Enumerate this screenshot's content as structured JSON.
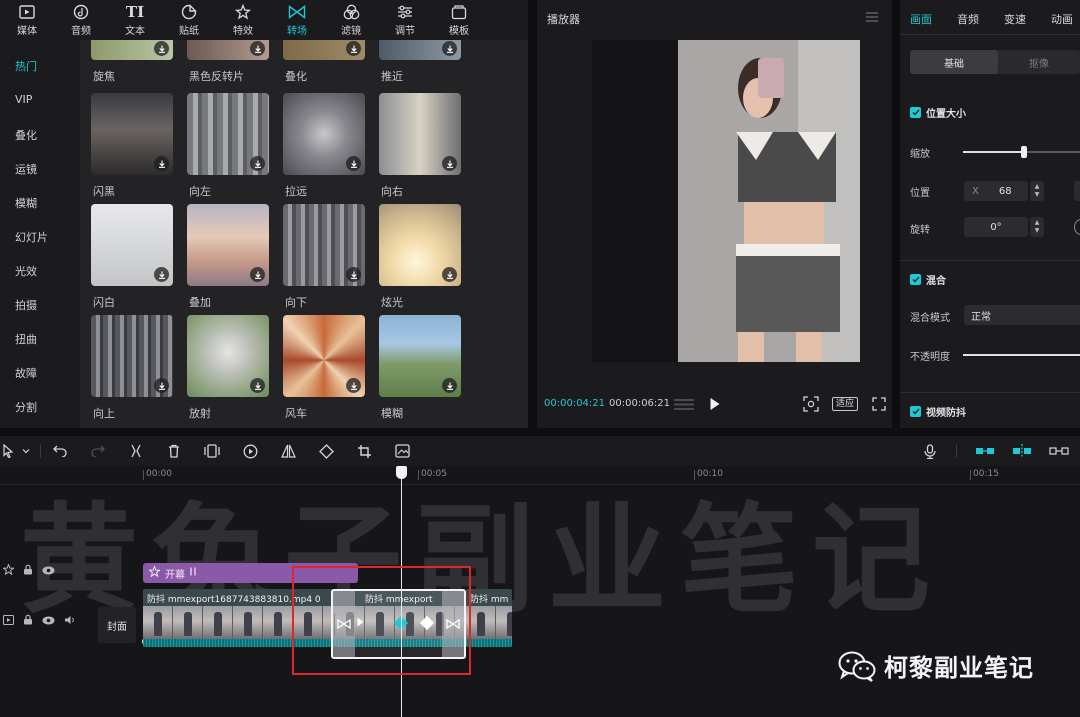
{
  "toolbar": {
    "items": [
      {
        "label": "媒体",
        "icon": "media-icon"
      },
      {
        "label": "音频",
        "icon": "audio-icon"
      },
      {
        "label": "文本",
        "icon": "text-icon",
        "glyph": "TI"
      },
      {
        "label": "贴纸",
        "icon": "sticker-icon"
      },
      {
        "label": "特效",
        "icon": "effects-icon"
      },
      {
        "label": "转场",
        "icon": "transition-icon",
        "active": true
      },
      {
        "label": "滤镜",
        "icon": "filter-icon"
      },
      {
        "label": "调节",
        "icon": "adjust-icon"
      },
      {
        "label": "模板",
        "icon": "template-icon"
      }
    ]
  },
  "categories": [
    "热门",
    "VIP",
    "叠化",
    "运镜",
    "模糊",
    "幻灯片",
    "光效",
    "拍摄",
    "扭曲",
    "故障",
    "分割"
  ],
  "active_category": "热门",
  "effects": {
    "row0": [
      "旋焦",
      "黑色反转片",
      "叠化",
      "推近"
    ],
    "row1": [
      "闪黑",
      "向左",
      "拉远",
      "向右"
    ],
    "row2": [
      "闪白",
      "叠加",
      "向下",
      "炫光"
    ],
    "row3": [
      "向上",
      "放射",
      "风车",
      "模糊"
    ]
  },
  "player": {
    "title": "播放器",
    "current_time": "00:00:04:21",
    "total_time": "00:00:06:21",
    "fit_label": "适应"
  },
  "properties": {
    "tabs": [
      "画面",
      "音频",
      "变速",
      "动画"
    ],
    "active_tab": "画面",
    "subtabs": [
      "基础",
      "抠像"
    ],
    "section_position": "位置大小",
    "scale_label": "缩放",
    "scale_level": 0.52,
    "position_label": "位置",
    "pos_x_label": "X",
    "pos_x_value": "68",
    "rotate_label": "旋转",
    "rotate_value": "0°",
    "section_blend": "混合",
    "blend_mode_label": "混合模式",
    "blend_mode_value": "正常",
    "opacity_label": "不透明度",
    "section_stabilize": "视频防抖"
  },
  "timeline": {
    "ticks": [
      "00:00",
      "00:05",
      "00:10",
      "00:15"
    ],
    "effect_clip_label": "开幕",
    "cover_label": "封面",
    "clip1_label": "防抖 mmexport1687743883810.mp4 0",
    "clip2_label": "防抖 mmexport",
    "clip3_label": "防抖 mm"
  },
  "watermark": "黄兔子副业笔记",
  "brand": "柯黎副业笔记",
  "colors": {
    "accent": "#1fc9d6",
    "highlight_box": "#e0262a",
    "effect_clip": "#8a5aa8"
  }
}
